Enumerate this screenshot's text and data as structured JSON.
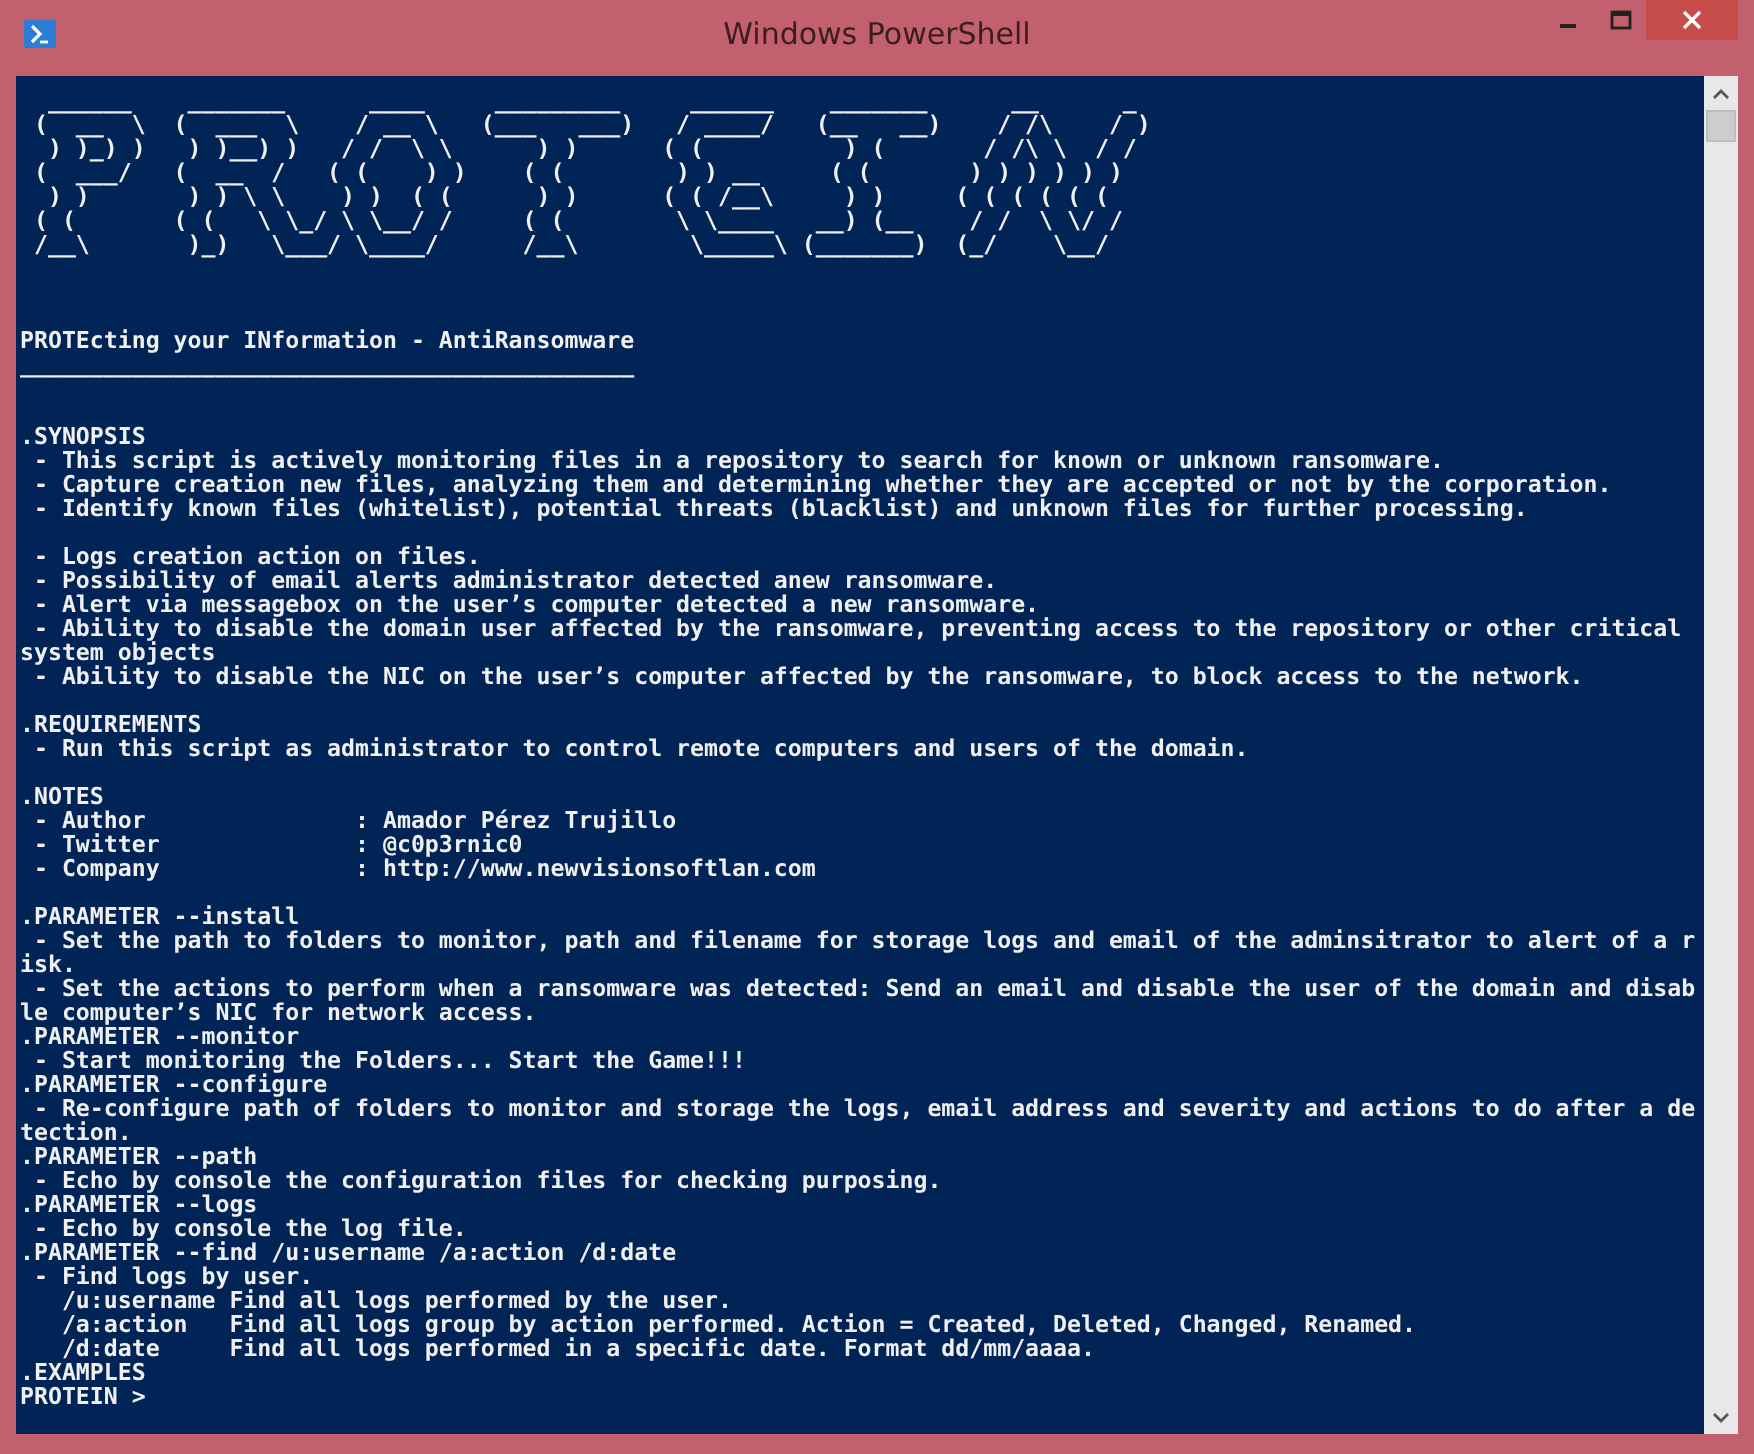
{
  "window": {
    "title": "Windows PowerShell"
  },
  "console": {
    "banner": {
      "lines": [
        "  ______    _______      ____     _________     ______    _______      __      _  ",
        " (  __  \\  (  ___  \\    / __ \\   (___   ___)   / ____/   (__   __)    / /\\    / ) ",
        "  ) )_) )   ) )__) )   / /  \\ \\      ) )      ( (          ) (       / /\\ \\  / /  ",
        " (  ___/   (  __  /   ( (    ) )    ( (        ) ) __     ( (       ) ) ) ) ) )   ",
        "  ) )       ) ) \\ \\    ) )  ( (      ) )      ( ( /__\\     ) )     ( ( ( ( ( (    ",
        " ( (       ( (   \\ \\_/ \\ \\__/ /     ( (        \\ \\____   __) (__    / /  \\ \\/ /   ",
        " /__\\       )_)   \\___/ \\____/      /__\\        \\_____\\ (_______)  (_/    \\__/    "
      ]
    },
    "lines": [
      {
        "kind": "blank"
      },
      {
        "kind": "blank"
      },
      {
        "kind": "blank"
      },
      {
        "kind": "text",
        "text": "PROTEcting your INformation - AntiRansomware"
      },
      {
        "kind": "text",
        "text": "____________________________________________"
      },
      {
        "kind": "blank"
      },
      {
        "kind": "blank"
      },
      {
        "kind": "text",
        "text": ".SYNOPSIS"
      },
      {
        "kind": "text",
        "text": " - This script is actively monitoring files in a repository to search for known or unknown ransomware."
      },
      {
        "kind": "text",
        "text": " - Capture creation new files, analyzing them and determining whether they are accepted or not by the corporation."
      },
      {
        "kind": "text",
        "text": " - Identify known files (whitelist), potential threats (blacklist) and unknown files for further processing."
      },
      {
        "kind": "blank"
      },
      {
        "kind": "text",
        "text": " - Logs creation action on files."
      },
      {
        "kind": "text",
        "text": " - Possibility of email alerts administrator detected anew ransomware."
      },
      {
        "kind": "text",
        "text": " - Alert via messagebox on the user’s computer detected a new ransomware."
      },
      {
        "kind": "text",
        "text": " - Ability to disable the domain user affected by the ransomware, preventing access to the repository or other critical"
      },
      {
        "kind": "text",
        "text": "system objects"
      },
      {
        "kind": "text",
        "text": " - Ability to disable the NIC on the user’s computer affected by the ransomware, to block access to the network."
      },
      {
        "kind": "blank"
      },
      {
        "kind": "text",
        "text": ".REQUIREMENTS"
      },
      {
        "kind": "text",
        "text": " - Run this script as administrator to control remote computers and users of the domain."
      },
      {
        "kind": "blank"
      },
      {
        "kind": "text",
        "text": ".NOTES"
      },
      {
        "kind": "text",
        "text": " - Author               : Amador Pérez Trujillo"
      },
      {
        "kind": "text",
        "text": " - Twitter              : @c0p3rnic0"
      },
      {
        "kind": "text",
        "text": " - Company              : http://www.newvisionsoftlan.com"
      },
      {
        "kind": "blank"
      },
      {
        "kind": "text",
        "text": ".PARAMETER --install"
      },
      {
        "kind": "text",
        "text": " - Set the path to folders to monitor, path and filename for storage logs and email of the adminsitrator to alert of a r"
      },
      {
        "kind": "text",
        "text": "isk."
      },
      {
        "kind": "text",
        "text": " - Set the actions to perform when a ransomware was detected: Send an email and disable the user of the domain and disab"
      },
      {
        "kind": "text",
        "text": "le computer’s NIC for network access."
      },
      {
        "kind": "text",
        "text": ".PARAMETER --monitor"
      },
      {
        "kind": "text",
        "text": " - Start monitoring the Folders... Start the Game!!!"
      },
      {
        "kind": "text",
        "text": ".PARAMETER --configure"
      },
      {
        "kind": "text",
        "text": " - Re-configure path of folders to monitor and storage the logs, email address and severity and actions to do after a de"
      },
      {
        "kind": "text",
        "text": "tection."
      },
      {
        "kind": "text",
        "text": ".PARAMETER --path"
      },
      {
        "kind": "text",
        "text": " - Echo by console the configuration files for checking purposing."
      },
      {
        "kind": "text",
        "text": ".PARAMETER --logs"
      },
      {
        "kind": "text",
        "text": " - Echo by console the log file."
      },
      {
        "kind": "text",
        "text": ".PARAMETER --find /u:username /a:action /d:date"
      },
      {
        "kind": "text",
        "text": " - Find logs by user."
      },
      {
        "kind": "text",
        "text": "   /u:username Find all logs performed by the user."
      },
      {
        "kind": "text",
        "text": "   /a:action   Find all logs group by action performed. Action = Created, Deleted, Changed, Renamed."
      },
      {
        "kind": "text",
        "text": "   /d:date     Find all logs performed in a specific date. Format dd/mm/aaaa."
      },
      {
        "kind": "text",
        "text": ".EXAMPLES"
      },
      {
        "kind": "text",
        "text": "PROTEIN >"
      }
    ]
  }
}
